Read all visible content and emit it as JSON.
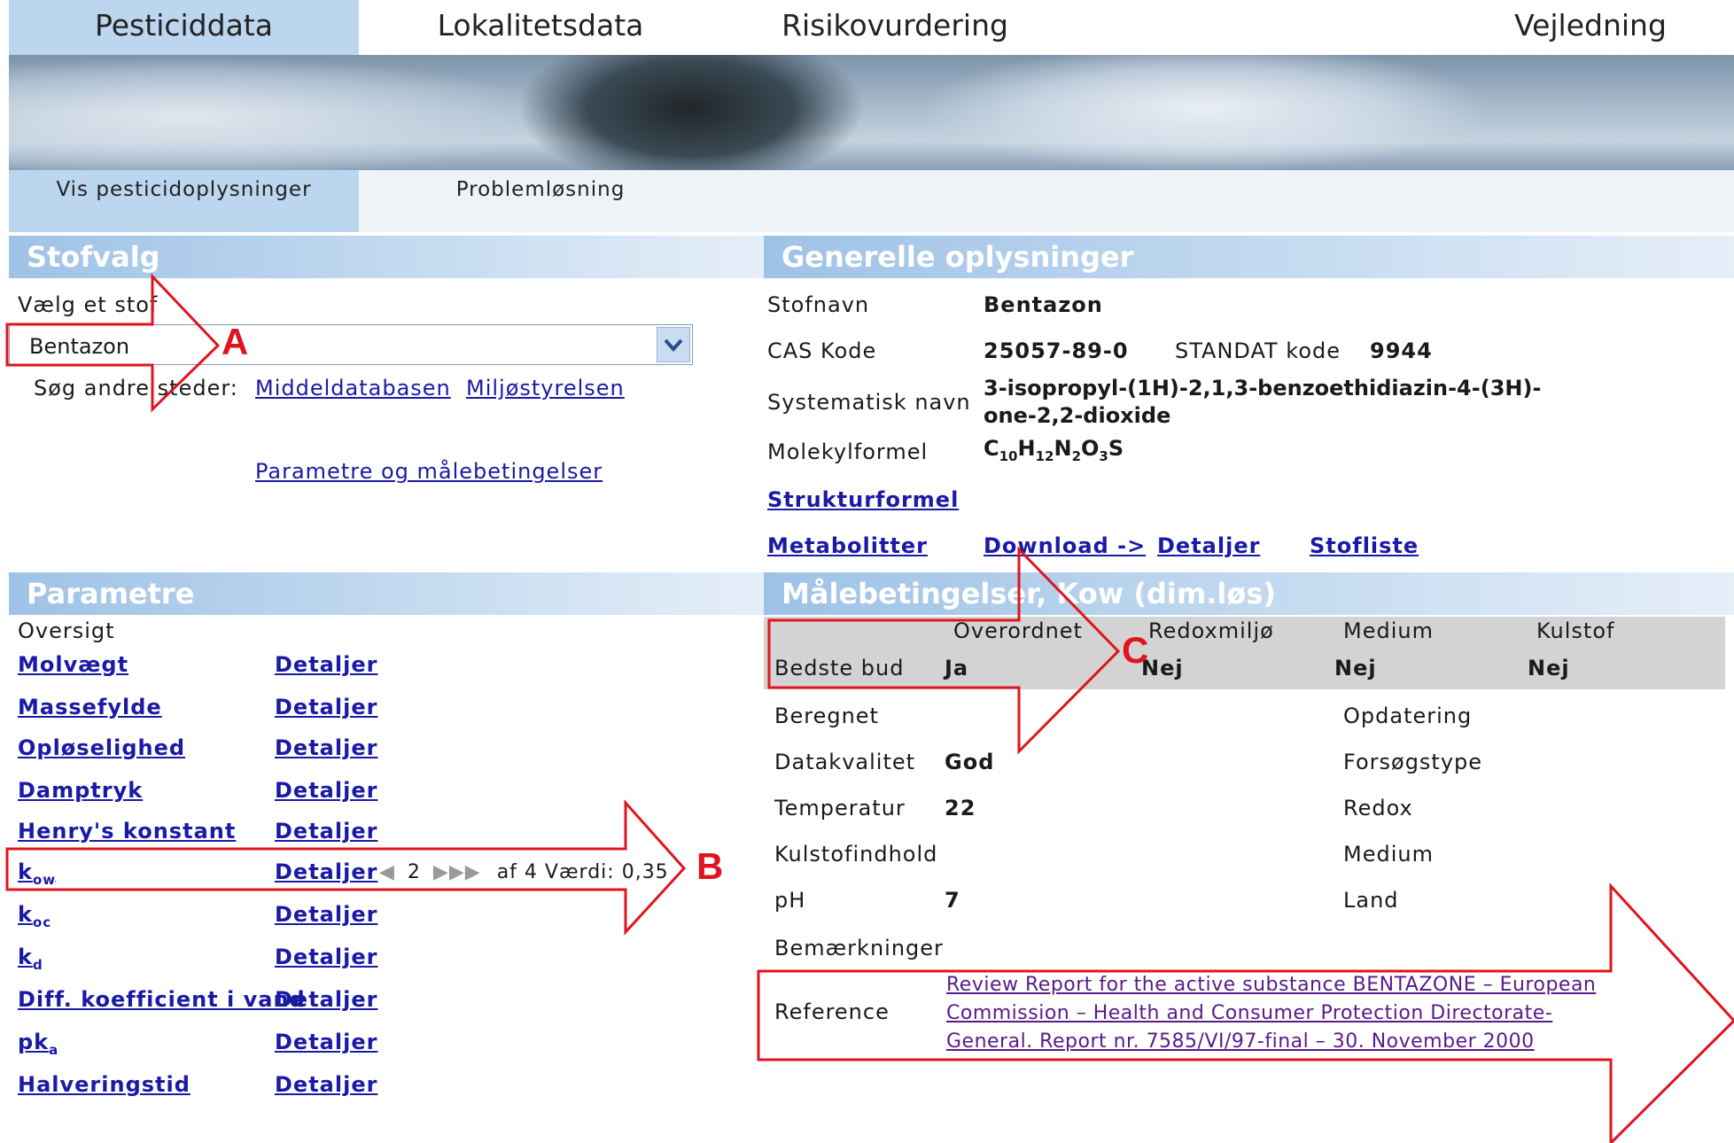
{
  "nav": {
    "tabs": [
      "Pesticiddata",
      "Lokalitetsdata",
      "Risikovurdering",
      "Vejledning"
    ]
  },
  "subnav": {
    "tabs": [
      "Vis pesticidoplysninger",
      "Problemløsning"
    ]
  },
  "stofvalg": {
    "header": "Stofvalg",
    "label": "Vælg et stof",
    "selected": "Bentazon",
    "search_label": "Søg andre steder:",
    "links": [
      "Middeldatabasen",
      "Miljøstyrelsen"
    ],
    "param_link": "Parametre og målebetingelser"
  },
  "generelle": {
    "header": "Generelle oplysninger",
    "stofnavn_label": "Stofnavn",
    "stofnavn": "Bentazon",
    "cas_label": "CAS Kode",
    "cas": "25057-89-0",
    "standat_label": "STANDAT kode",
    "standat": "9944",
    "systematisk_label": "Systematisk navn",
    "systematisk_1": "3-isopropyl-(1H)-2,1,3-benzoethidiazin-4-(3H)-",
    "systematisk_2": "one-2,2-dioxide",
    "molekyl_label": "Molekylformel",
    "formula": [
      {
        "t": "C",
        "s": "10"
      },
      {
        "t": "H",
        "s": "12"
      },
      {
        "t": "N",
        "s": "2"
      },
      {
        "t": "O",
        "s": "3"
      },
      {
        "t": "S",
        "s": ""
      }
    ],
    "strukturformel": "Strukturformel",
    "metabolitter": "Metabolitter",
    "download": "Download ->",
    "detaljer": "Detaljer",
    "stofliste": "Stofliste"
  },
  "parametre": {
    "header": "Parametre",
    "oversigt": "Oversigt",
    "detail_label": "Detaljer",
    "items": [
      {
        "name": "Molvægt",
        "sub": ""
      },
      {
        "name": "Massefylde",
        "sub": ""
      },
      {
        "name": "Opløselighed",
        "sub": ""
      },
      {
        "name": "Damptryk",
        "sub": ""
      },
      {
        "name": "Henry's konstant",
        "sub": ""
      },
      {
        "name": "k",
        "sub": "ow"
      },
      {
        "name": "k",
        "sub": "oc"
      },
      {
        "name": "k",
        "sub": "d"
      },
      {
        "name": "Diff. koefficient i vand",
        "sub": ""
      },
      {
        "name": "pk",
        "sub": "a"
      },
      {
        "name": "Halveringstid",
        "sub": ""
      }
    ],
    "pager": {
      "page": "2",
      "of": "af 4",
      "vaerdi": "Værdi: 0,35"
    }
  },
  "maale": {
    "header": "Målebetingelser, Kow (dim.løs)",
    "cols": [
      "Overordnet",
      "Redoxmiljø",
      "Medium",
      "Kulstof"
    ],
    "bedste_label": "Bedste bud",
    "bedste": [
      "Ja",
      "Nej",
      "Nej",
      "Nej"
    ],
    "beregnet": "Beregnet",
    "datakvalitet_label": "Datakvalitet",
    "datakvalitet": "God",
    "temperatur_label": "Temperatur",
    "temperatur": "22",
    "kulstofindhold": "Kulstofindhold",
    "ph_label": "pH",
    "ph": "7",
    "bemaerkninger": "Bemærkninger",
    "opdatering": "Opdatering",
    "forsoegstype": "Forsøgstype",
    "redox": "Redox",
    "medium": "Medium",
    "land": "Land",
    "reference_label": "Reference",
    "reference_1": "Review Report for the active substance BENTAZONE – European",
    "reference_2": "Commission – Health and Consumer Protection Directorate-",
    "reference_3": "General. Report nr. 7585/VI/97-final – 30. November 2000"
  },
  "annotations": {
    "a": "A",
    "b": "B",
    "c": "C"
  },
  "colors": {
    "tab_active": "#bcd6ef",
    "header_gradient": "#9ec2e6",
    "link": "#1a1aa6",
    "annotation": "#e0141e"
  }
}
